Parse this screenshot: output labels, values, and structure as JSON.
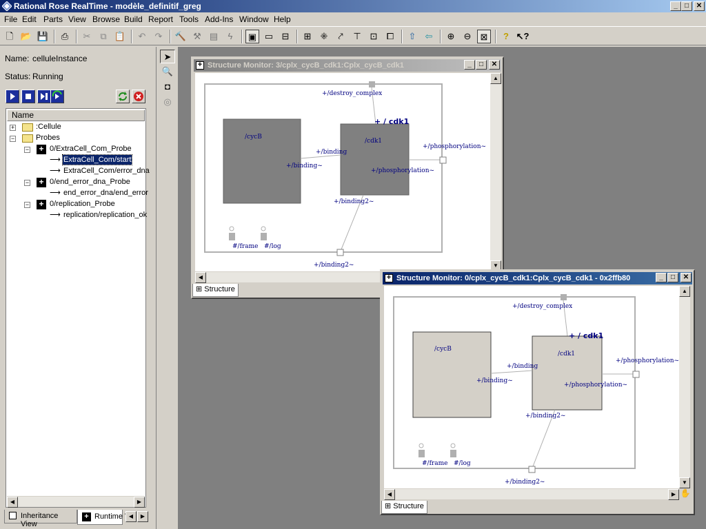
{
  "app": {
    "title": "Rational Rose RealTime - modèle_definitif_greg"
  },
  "window_controls": {
    "minimize": "_",
    "maximize": "□",
    "close": "✕"
  },
  "menu": [
    "File",
    "Edit",
    "Parts",
    "View",
    "Browse",
    "Build",
    "Report",
    "Tools",
    "Add-Ins",
    "Window",
    "Help"
  ],
  "toolbar_icons": [
    "new-icon",
    "open-icon",
    "save-icon",
    "print-icon",
    "cut-icon",
    "copy-icon",
    "paste-icon",
    "undo-icon",
    "redo-icon",
    "build-icon",
    "rebuild-icon",
    "run-icon",
    "debug-icon",
    "structure-icon",
    "state-icon",
    "browser-icon",
    "layout-icon",
    "split-icon",
    "wire-icon",
    "merge-icon",
    "capsule-icon",
    "port-icon",
    "home-icon",
    "back-icon",
    "zoom-in-icon",
    "zoom-out-icon",
    "fit-icon",
    "help-icon",
    "context-help-icon"
  ],
  "instance": {
    "name_label": "Name:",
    "name_value": "celluleInstance",
    "status_label": "Status:",
    "status_value": "Running"
  },
  "tree": {
    "column_header": "Name",
    "items": [
      {
        "label": ":Cellule",
        "kind": "folder",
        "expander": "+"
      },
      {
        "label": "Probes",
        "kind": "folder",
        "expander": "−"
      },
      {
        "label": "0/ExtraCell_Com_Probe",
        "kind": "probe",
        "expander": "−"
      },
      {
        "label": "ExtraCell_Com/start",
        "kind": "signal",
        "selected": true
      },
      {
        "label": "ExtraCell_Com/error_dna",
        "kind": "signal"
      },
      {
        "label": "0/end_error_dna_Probe",
        "kind": "probe",
        "expander": "−"
      },
      {
        "label": "end_error_dna/end_error",
        "kind": "signal"
      },
      {
        "label": "0/replication_Probe",
        "kind": "probe",
        "expander": "−"
      },
      {
        "label": "replication/replication_ok",
        "kind": "signal"
      }
    ]
  },
  "bottom_tabs": {
    "inheritance": "Inheritance View",
    "runtime": "Runtime V"
  },
  "monitor1": {
    "title": "Structure Monitor: 3/cplx_cycB_cdk1:Cplx_cycB_cdk1",
    "tab": "Structure",
    "labels": {
      "destroy": "+/destroy_complex",
      "cdk1_header": "+ / cdk1",
      "cycB": "/cycB",
      "cdk1": "/cdk1",
      "binding_top": "+/binding",
      "binding_left": "+/binding~",
      "phos_inner": "+/phosphorylation~",
      "phos_outer": "+/phosphorylation~",
      "binding2": "+/binding2~",
      "binding2_bottom": "+/binding2~",
      "frame": "#/frame",
      "log": "#/log"
    }
  },
  "monitor2": {
    "title": "Structure Monitor: 0/cplx_cycB_cdk1:Cplx_cycB_cdk1 - 0x2ffb80",
    "tab": "Structure",
    "labels": {
      "destroy": "+/destroy_complex",
      "cdk1_header": "+ / cdk1",
      "cycB": "/cycB",
      "cdk1": "/cdk1",
      "binding_top": "+/binding",
      "binding_left": "+/binding~",
      "phos_inner": "+/phosphorylation~",
      "phos_outer": "+/phosphorylation~",
      "binding2": "+/binding2~",
      "binding2_bottom": "+/binding2~",
      "frame": "#/frame",
      "log": "#/log"
    }
  },
  "colors": {
    "title_active": "#0a246a",
    "title_inactive": "#808080",
    "capsule_running": "#808080",
    "capsule_idle": "#d4d0c8",
    "label": "#000080"
  }
}
